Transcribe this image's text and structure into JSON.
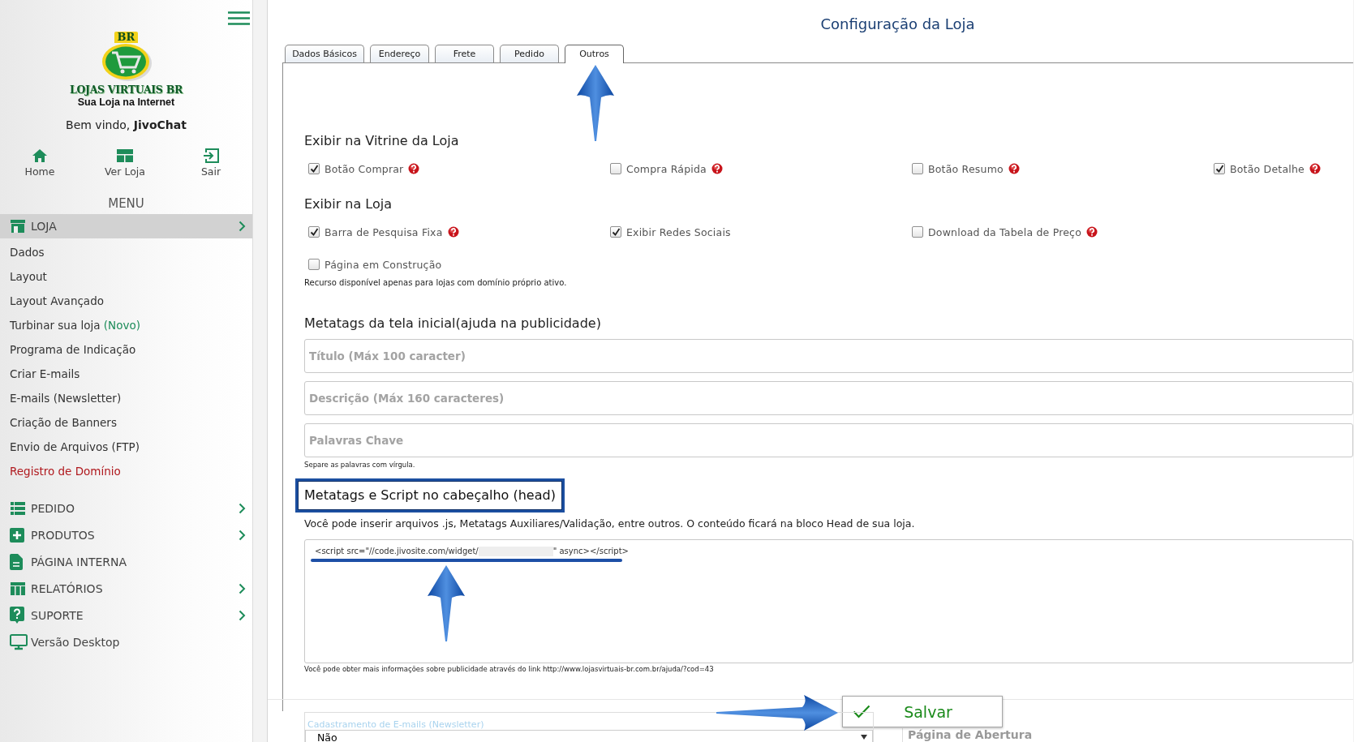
{
  "sidebar": {
    "logo": {
      "badge": "BR",
      "name": "LOJAS VIRTUAIS BR",
      "tagline": "Sua Loja na Internet"
    },
    "welcome": {
      "text": "Bem vindo, ",
      "user": "JivoChat"
    },
    "nav": [
      {
        "label": "Home"
      },
      {
        "label": "Ver Loja"
      },
      {
        "label": "Sair"
      }
    ],
    "menu_title": "MENU",
    "sections": [
      {
        "label": "LOJA",
        "selected": true,
        "chevron": true,
        "children": [
          {
            "label": "Dados",
            "color": "#333333"
          },
          {
            "label": "Layout",
            "color": "#333333"
          },
          {
            "label": "Layout Avançado",
            "color": "#333333"
          },
          {
            "label": "Turbinar sua loja",
            "badge": "(Novo)",
            "color": "#333333"
          },
          {
            "label": "Programa de Indicação",
            "color": "#333333"
          },
          {
            "label": "Criar E-mails",
            "color": "#333333"
          },
          {
            "label": "E-mails (Newsletter)",
            "color": "#333333"
          },
          {
            "label": "Criação de Banners",
            "color": "#333333"
          },
          {
            "label": "Envio de Arquivos (FTP)",
            "color": "#333333"
          },
          {
            "label": "Registro de Domínio",
            "color": "#b0191e"
          }
        ]
      },
      {
        "label": "PEDIDO",
        "selected": false,
        "chevron": true
      },
      {
        "label": "PRODUTOS",
        "selected": false,
        "chevron": true
      },
      {
        "label": "PÁGINA INTERNA",
        "selected": false,
        "chevron": false
      },
      {
        "label": "RELATÓRIOS",
        "selected": false,
        "chevron": true
      },
      {
        "label": "SUPORTE",
        "selected": false,
        "chevron": true
      },
      {
        "label": "Versão Desktop",
        "selected": false,
        "chevron": false
      }
    ]
  },
  "main": {
    "title": "Configuração da Loja",
    "tabs": [
      {
        "label": "Dados Básicos",
        "selected": false
      },
      {
        "label": "Endereço",
        "selected": false
      },
      {
        "label": "Frete",
        "selected": false
      },
      {
        "label": "Pedido",
        "selected": false
      },
      {
        "label": "Outros",
        "selected": true
      }
    ],
    "groups": [
      {
        "heading": "Exibir na Vitrine da Loja",
        "rows": [
          [
            {
              "label": "Botão Comprar",
              "checked": true,
              "help": true
            },
            {
              "label": "Compra Rápida",
              "checked": false,
              "help": true
            },
            {
              "label": "Botão Resumo",
              "checked": false,
              "help": true
            },
            {
              "label": "Botão Detalhe",
              "checked": true,
              "help": true
            }
          ]
        ]
      },
      {
        "heading": "Exibir na Loja",
        "rows": [
          [
            {
              "label": "Barra de Pesquisa Fixa",
              "checked": true,
              "help": true
            },
            {
              "label": "Exibir Redes Sociais",
              "checked": true,
              "help": false
            },
            {
              "label": "Download da Tabela de Preço",
              "checked": false,
              "help": true
            }
          ],
          [
            {
              "label": "Página em Construção",
              "checked": false,
              "help": false
            }
          ]
        ],
        "note": "Recurso disponível apenas para lojas com domínio próprio ativo."
      }
    ],
    "metatags": {
      "heading": "Metatags da tela inicial(ajuda na publicidade)",
      "fields": [
        {
          "placeholder": "Título (Máx 100 caracter)"
        },
        {
          "placeholder": "Descrição (Máx 160 caracteres)"
        },
        {
          "placeholder": "Palavras Chave"
        }
      ],
      "note": "Separe as palavras com vírgula."
    },
    "head_script": {
      "heading": "Metatags e Script no cabeçalho (head)",
      "highlighted": true,
      "description": "Você pode inserir arquivos .js, Metatags Auxiliares/Validação, entre outros. O conteúdo ficará na bloco Head de sua loja.",
      "value_parts": [
        "<script src=\"//code.jivosite.com/widget/",
        "\" async></script>"
      ],
      "redacted": true,
      "underlined": true,
      "footnote": "Você pode obter mais informações sobre publicidade através do link http://www.lojasvirtuais-br.com.br/ajuda/?cod=43"
    },
    "save_button": "Salvar",
    "newsletter": {
      "label": "Cadastramento de E-mails (Newsletter)",
      "value": "Não"
    },
    "opening_page": {
      "label": "Página de Abertura"
    }
  },
  "annotations": [
    {
      "kind": "uparrow"
    },
    {
      "kind": "uparrow"
    },
    {
      "kind": "rightarrow"
    }
  ]
}
